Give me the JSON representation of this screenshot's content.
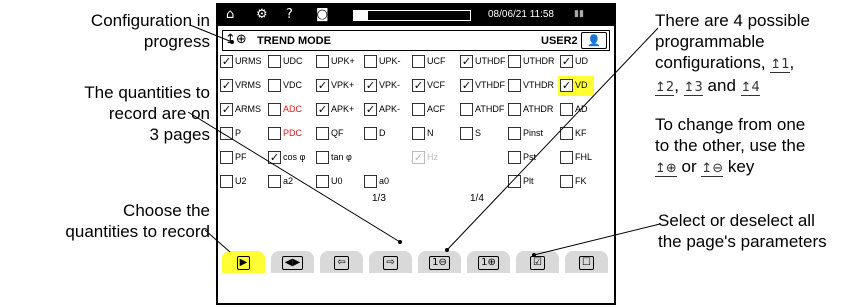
{
  "annotations": {
    "config_progress": [
      "Configuration in",
      "progress"
    ],
    "pages": [
      "The quantities to",
      "record are on",
      "3 pages"
    ],
    "choose": [
      "Choose the",
      "quantities to record"
    ],
    "programmable": [
      "There are 4 possible",
      "programmable",
      "configurations,"
    ],
    "programmable_list": {
      "sep1": ",",
      "sep2": ", ",
      "and": " and "
    },
    "change": [
      "To change from one",
      "to the other, use the"
    ],
    "change_keys": {
      "or": " or ",
      "key": " key"
    },
    "select": [
      "Select or deselect all",
      "the page's parameters"
    ]
  },
  "config_icons": {
    "c1": "1",
    "c2": "2",
    "c3": "3",
    "c4": "4",
    "prev": "⊖",
    "next": "⊕"
  },
  "status_bar": {
    "home_icon": "home-icon",
    "datetime": "08/06/21 11:58",
    "progress": 0.12,
    "battery_icon": "battery-icon"
  },
  "mode_bar": {
    "title": "TREND MODE",
    "user": "USER2"
  },
  "rows": [
    [
      {
        "label": "URMS",
        "checked": true
      },
      {
        "label": "UDC",
        "checked": false
      },
      {
        "label": "UPK+",
        "checked": false
      },
      {
        "label": "UPK-",
        "checked": false
      },
      {
        "label": "UCF",
        "checked": false
      },
      {
        "label": "UTHDF",
        "checked": true
      },
      {
        "label": "UTHDR",
        "checked": false
      },
      {
        "label": "UD",
        "checked": true
      }
    ],
    [
      {
        "label": "VRMS",
        "checked": true
      },
      {
        "label": "VDC",
        "checked": false
      },
      {
        "label": "VPK+",
        "checked": true
      },
      {
        "label": "VPK-",
        "checked": true
      },
      {
        "label": "VCF",
        "checked": true
      },
      {
        "label": "VTHDF",
        "checked": true
      },
      {
        "label": "VTHDR",
        "checked": false
      },
      {
        "label": "VD",
        "checked": true,
        "highlight": true
      }
    ],
    [
      {
        "label": "ARMS",
        "checked": true
      },
      {
        "label": "ADC",
        "checked": false,
        "red": true
      },
      {
        "label": "APK+",
        "checked": true
      },
      {
        "label": "APK-",
        "checked": true
      },
      {
        "label": "ACF",
        "checked": false
      },
      {
        "label": "ATHDF",
        "checked": false
      },
      {
        "label": "ATHDR",
        "checked": false
      },
      {
        "label": "AD",
        "checked": false
      }
    ],
    [
      {
        "label": "P",
        "checked": false
      },
      {
        "label": "PDC",
        "checked": false,
        "red": true
      },
      {
        "label": "QF",
        "checked": false
      },
      {
        "label": "D",
        "checked": false
      },
      {
        "label": "N",
        "checked": false
      },
      {
        "label": "S",
        "checked": false
      },
      {
        "label": "Pinst",
        "checked": false
      },
      {
        "label": "KF",
        "checked": false
      }
    ],
    [
      {
        "label": "PF",
        "checked": false
      },
      {
        "label": "cos φ",
        "checked": true
      },
      {
        "label": "tan φ",
        "checked": false
      },
      {
        "label": "",
        "checked": false,
        "empty": true
      },
      {
        "label": "Hz",
        "checked": true,
        "disabled": true
      },
      {
        "label": "",
        "checked": false,
        "empty": true
      },
      {
        "label": "Pst",
        "checked": false
      },
      {
        "label": "FHL",
        "checked": false
      }
    ],
    [
      {
        "label": "U2",
        "checked": false
      },
      {
        "label": "a2",
        "checked": false
      },
      {
        "label": "U0",
        "checked": false
      },
      {
        "label": "a0",
        "checked": false
      },
      {
        "label": "",
        "checked": false,
        "empty": true
      },
      {
        "label": "",
        "checked": false,
        "empty": true
      },
      {
        "label": "Plt",
        "checked": false
      },
      {
        "label": "FK",
        "checked": false
      }
    ]
  ],
  "page_indicators": {
    "page": "1/3",
    "config": "1/4"
  },
  "function_keys": [
    {
      "name": "fkey-play",
      "icon": "▶",
      "active": true
    },
    {
      "name": "fkey-record",
      "icon": "◀▶",
      "active": false
    },
    {
      "name": "fkey-page-prev",
      "icon": "⇦",
      "active": false
    },
    {
      "name": "fkey-page-next",
      "icon": "⇨",
      "active": false
    },
    {
      "name": "fkey-config-prev",
      "icon": "1⊖",
      "active": false
    },
    {
      "name": "fkey-config-next",
      "icon": "1⊕",
      "active": false
    },
    {
      "name": "fkey-select-all",
      "icon": "☑",
      "active": false
    },
    {
      "name": "fkey-deselect-all",
      "icon": "☐",
      "active": false
    }
  ]
}
